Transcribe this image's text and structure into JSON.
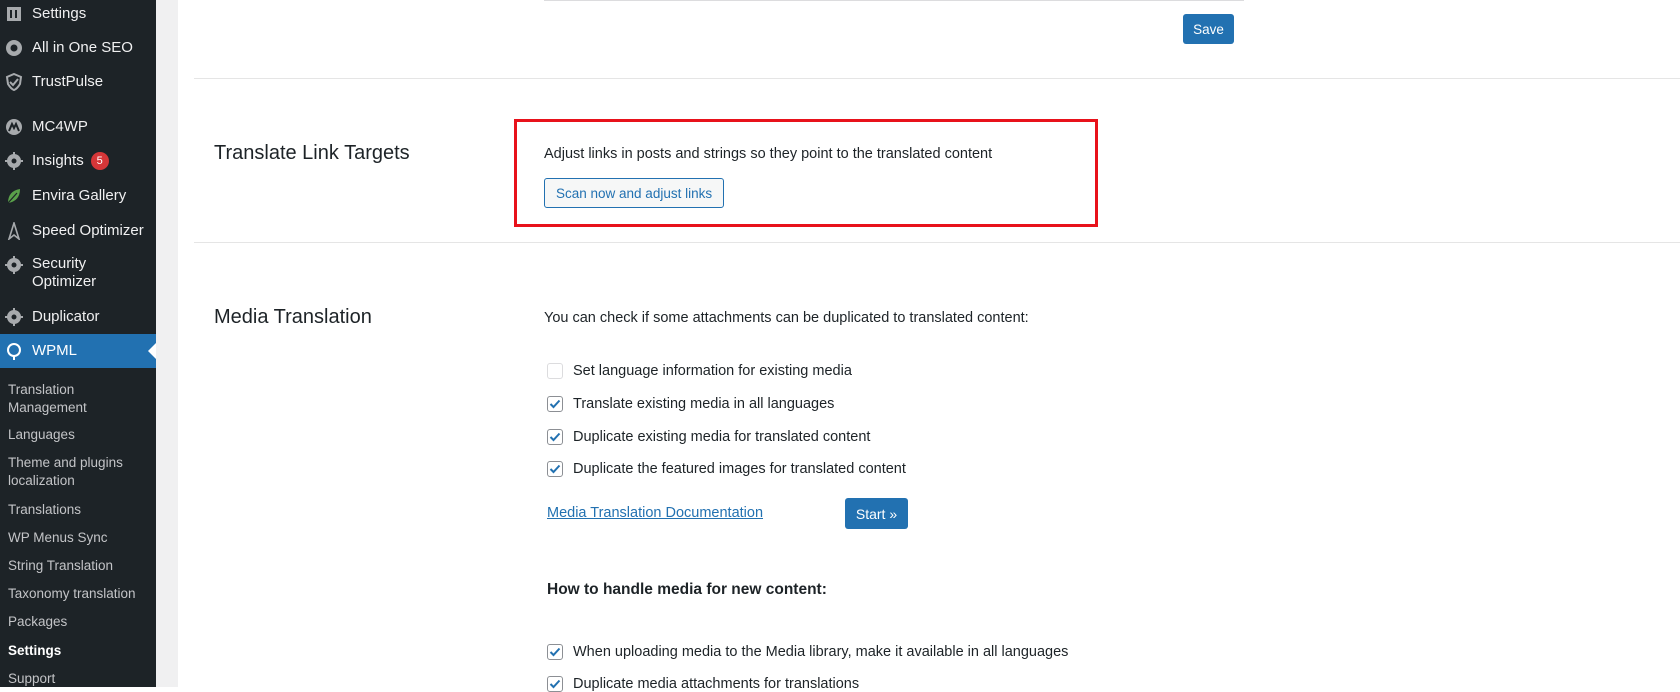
{
  "sidebar": {
    "menu": [
      {
        "label": "Settings",
        "icon": "settings-icon"
      },
      {
        "label": "All in One SEO",
        "icon": "aioseo-icon"
      },
      {
        "label": "TrustPulse",
        "icon": "trustpulse-icon"
      },
      {
        "label": "MC4WP",
        "icon": "mc4wp-icon"
      },
      {
        "label": "Insights",
        "icon": "insights-icon",
        "badge": "5"
      },
      {
        "label": "Envira Gallery",
        "icon": "leaf-icon"
      },
      {
        "label": "Speed Optimizer",
        "icon": "speed-icon"
      },
      {
        "label": "Security Optimizer",
        "icon": "security-icon"
      },
      {
        "label": "Duplicator",
        "icon": "duplicator-icon"
      },
      {
        "label": "WPML",
        "icon": "wpml-icon"
      }
    ],
    "submenu": [
      "Translation Management",
      "Languages",
      "Theme and plugins localization",
      "Translations",
      "WP Menus Sync",
      "String Translation",
      "Taxonomy translation",
      "Packages",
      "Settings",
      "Support"
    ]
  },
  "top": {
    "save_label": "Save"
  },
  "link_targets": {
    "title": "Translate Link Targets",
    "description": "Adjust links in posts and strings so they point to the translated content",
    "button_label": "Scan now and adjust links"
  },
  "media": {
    "title": "Media Translation",
    "intro": "You can check if some attachments can be duplicated to translated content:",
    "options": [
      {
        "label": "Set language information for existing media",
        "checked": false
      },
      {
        "label": "Translate existing media in all languages",
        "checked": true
      },
      {
        "label": "Duplicate existing media for translated content",
        "checked": true
      },
      {
        "label": "Duplicate the featured images for translated content",
        "checked": true
      }
    ],
    "doc_link": "Media Translation Documentation",
    "start_label": "Start »",
    "new_content_heading": "How to handle media for new content:",
    "new_options": [
      {
        "label": "When uploading media to the Media library, make it available in all languages",
        "checked": true
      },
      {
        "label": "Duplicate media attachments for translations",
        "checked": true
      }
    ]
  },
  "colors": {
    "sidebar_bg": "#1d2327",
    "accent": "#2271b1",
    "highlight_border": "#e8121b",
    "badge": "#d63638"
  }
}
